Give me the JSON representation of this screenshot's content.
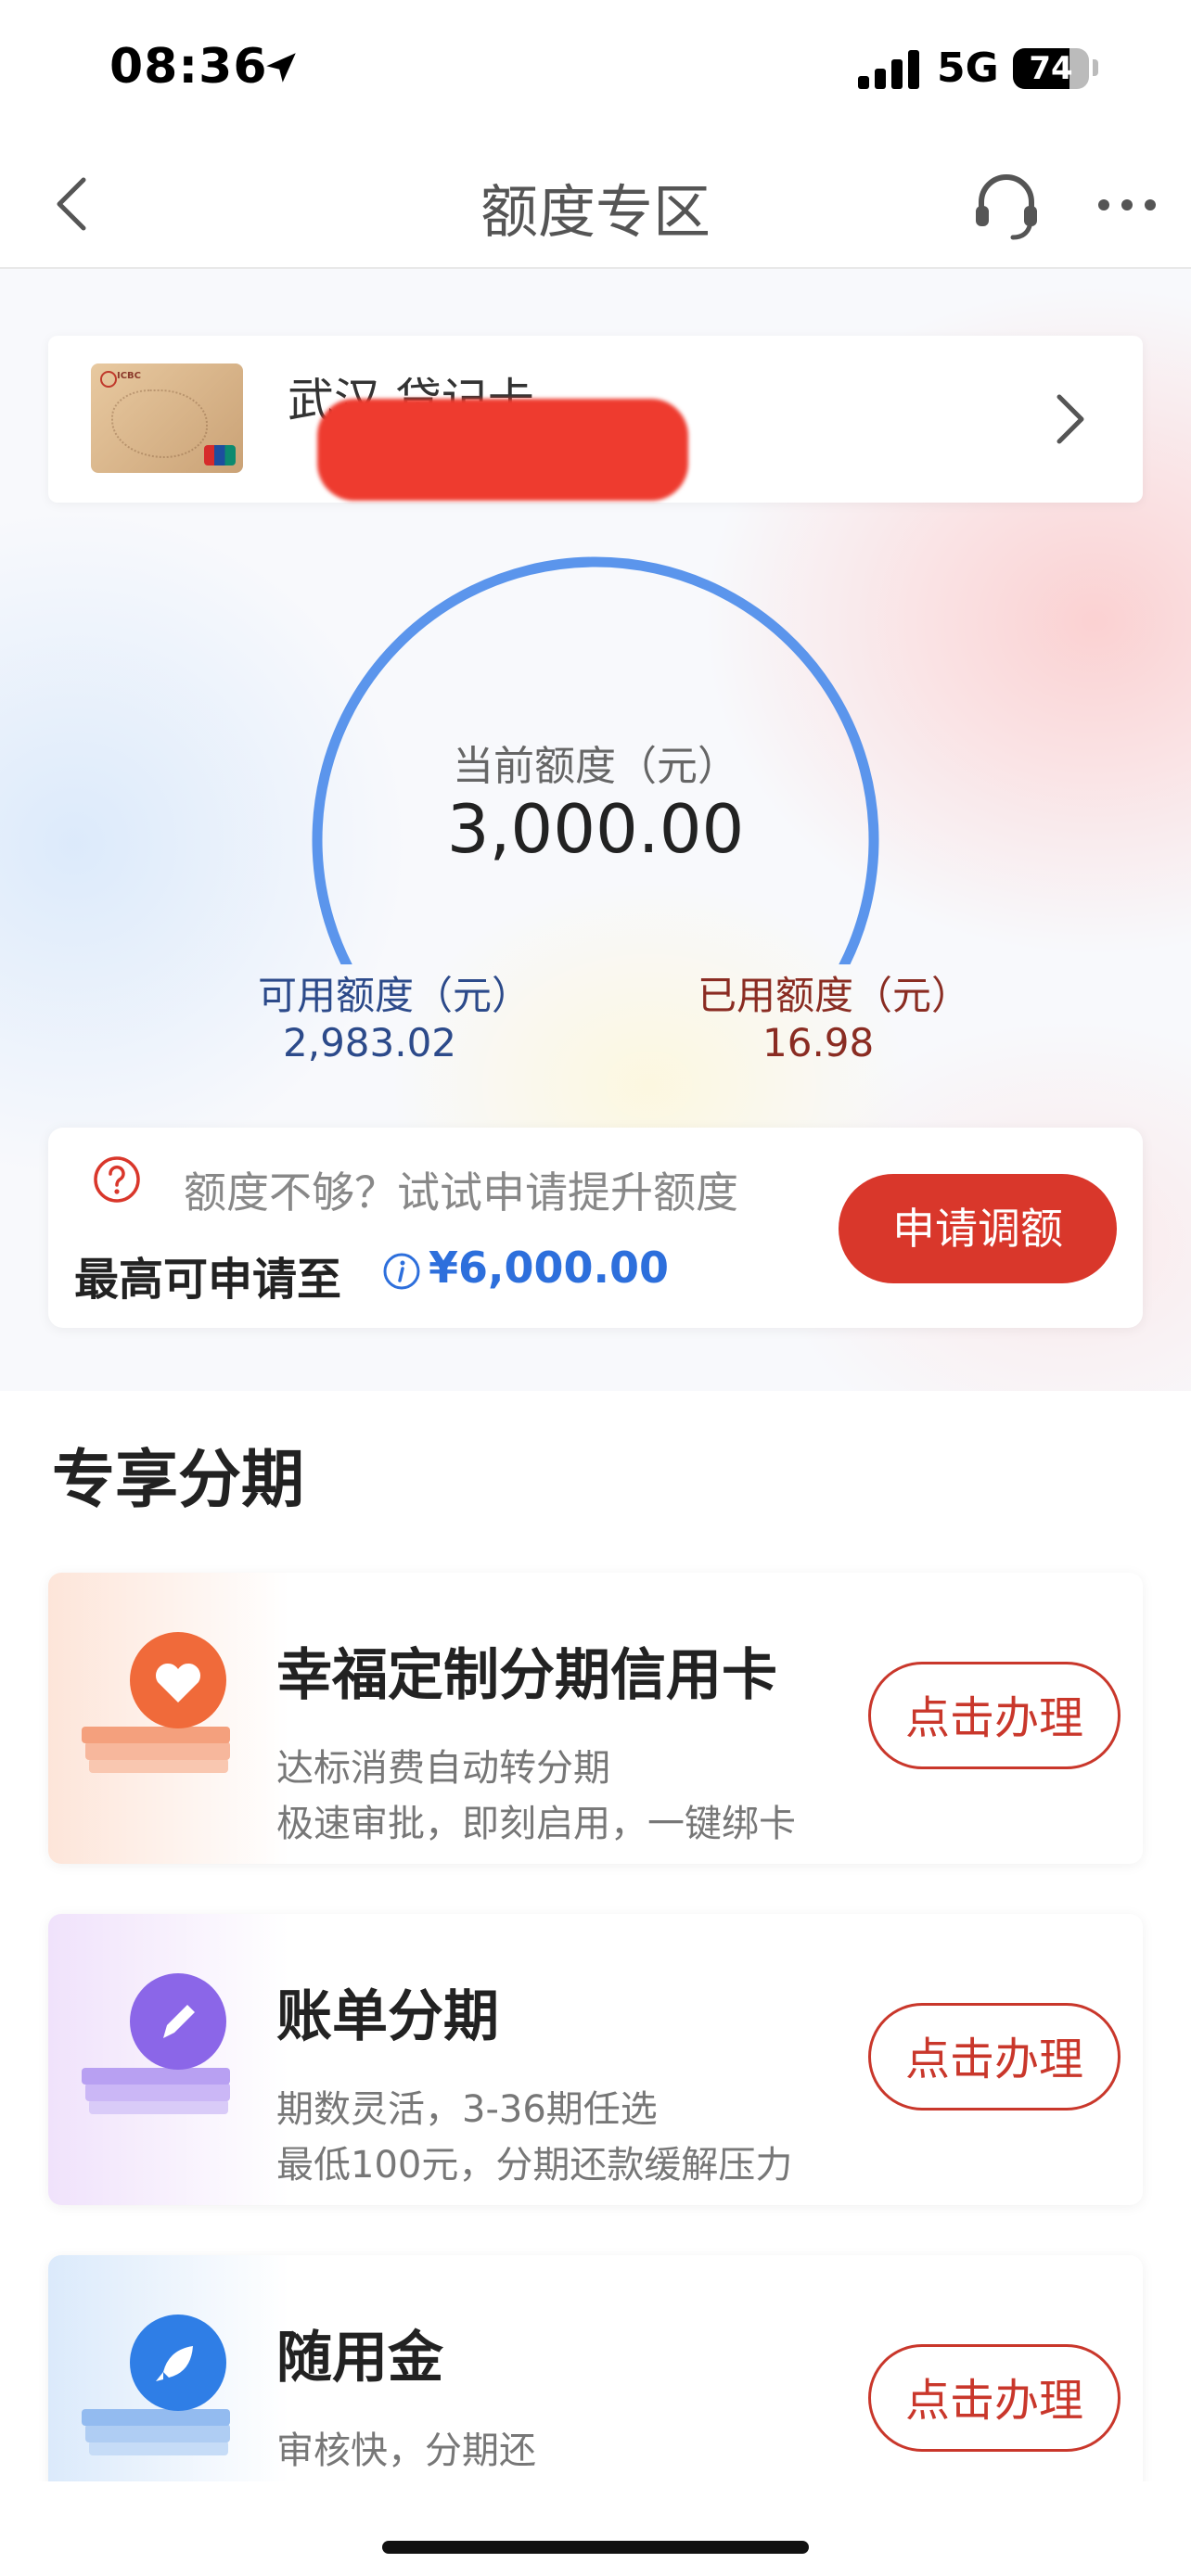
{
  "status_bar": {
    "time": "08:36",
    "network": "5G",
    "battery": "74",
    "battery_level": 0.74
  },
  "nav": {
    "title": "额度专区",
    "icons": [
      "back-chevron-icon",
      "headset-icon",
      "more-dots-icon"
    ]
  },
  "card": {
    "name": "武汉 贷记卡",
    "number_redacted": true
  },
  "gauge": {
    "label": "当前额度（元）",
    "value": "3,000.00",
    "used_fraction": 0.00566,
    "arc_color": "#5b95ec",
    "used_color": "#e2532f"
  },
  "available": {
    "label": "可用额度（元）",
    "value": "2,983.02"
  },
  "used": {
    "label": "已用额度（元）",
    "value": "16.98"
  },
  "increase": {
    "hint": "额度不够？试试申请提升额度",
    "max_label": "最高可申请至",
    "max_value": "¥6,000.00",
    "button": "申请调额"
  },
  "section": {
    "title": "专享分期"
  },
  "products": [
    {
      "title": "幸福定制分期信用卡",
      "line1": "达标消费自动转分期",
      "line2": "极速审批，即刻启用，一键绑卡",
      "button": "点击办理",
      "icon": "heart-icon",
      "color": "#f06a3a"
    },
    {
      "title": "账单分期",
      "line1": "期数灵活，3-36期任选",
      "line2": "最低100元，分期还款缓解压力",
      "button": "点击办理",
      "icon": "pencil-icon",
      "color": "#8b66e8"
    },
    {
      "title": "随用金",
      "line1": "审核快，分期还",
      "button": "点击办理",
      "icon": "rocket-icon",
      "color": "#2f7ee6"
    }
  ]
}
